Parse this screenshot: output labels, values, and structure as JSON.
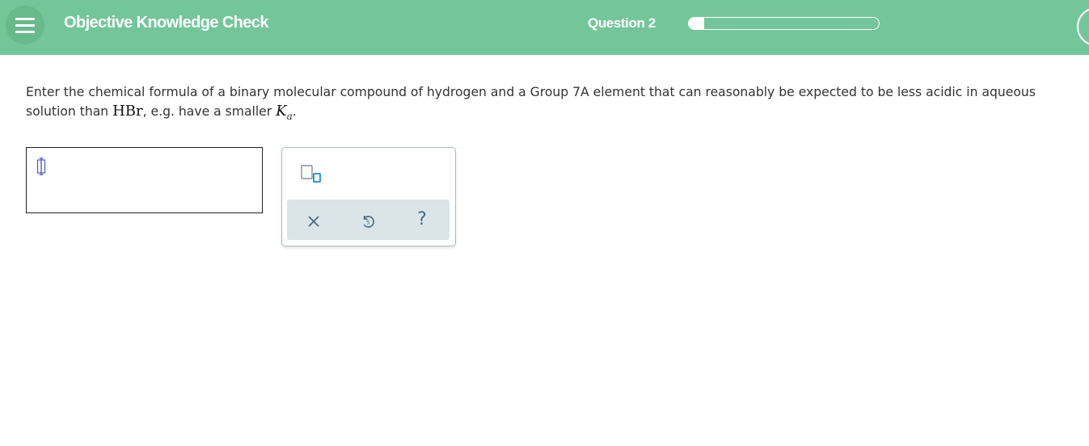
{
  "header": {
    "title": "Objective Knowledge Check",
    "question_label": "Question 2",
    "progress_fraction": 0.08
  },
  "question": {
    "prompt_line1": "Enter the chemical formula of a binary molecular compound of hydrogen and a Group 7A element that can reasonably be expected to be less acidic in aqueous",
    "prompt_line2_start": "solution than ",
    "compound": "HBr",
    "prompt_line2_mid": ", e.g. have a smaller ",
    "constant_symbol": "K",
    "constant_subscript": "a",
    "prompt_line2_end": "."
  },
  "answer": {
    "value": ""
  },
  "palette": {
    "buttons": {
      "subscript": "subscript-icon",
      "clear": "close-icon",
      "undo": "undo-icon",
      "help": "?"
    }
  },
  "colors": {
    "header_bg": "#73c699",
    "accent_blue": "#1a8fcf",
    "icon_gray": "#4a6a82"
  }
}
